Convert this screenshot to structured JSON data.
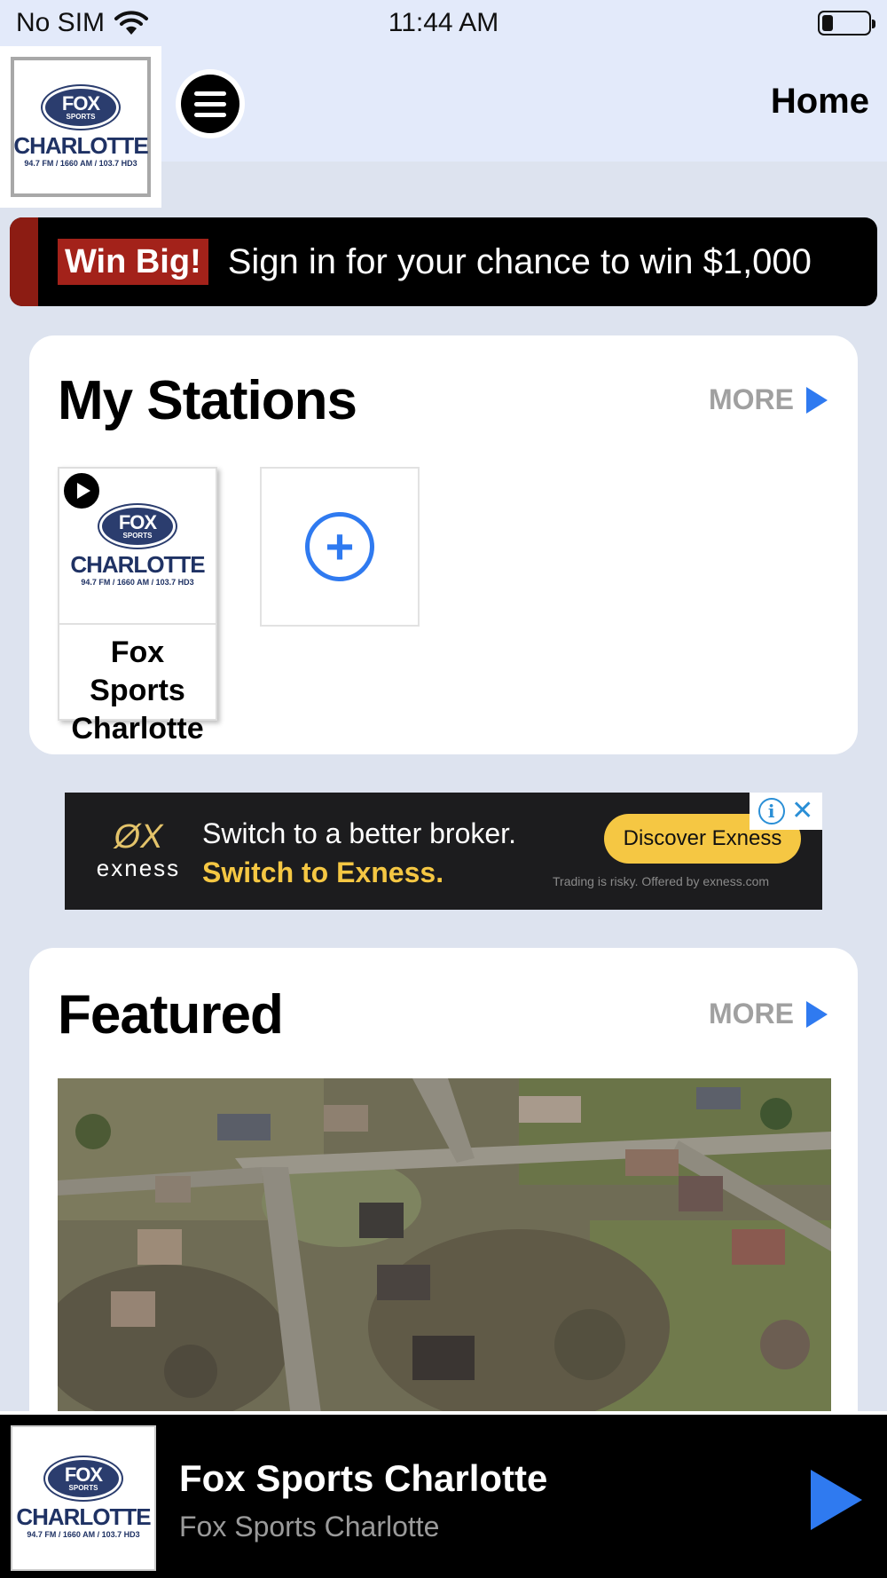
{
  "status_bar": {
    "carrier": "No SIM",
    "time": "11:44 AM"
  },
  "header": {
    "title": "Home",
    "logo": {
      "brand": "FOX",
      "sub": "SPORTS",
      "city": "CHARLOTTE",
      "frequencies": "94.7 FM / 1660 AM / 103.7 HD3"
    }
  },
  "promo": {
    "badge": "Win Big!",
    "text": "Sign in for your chance to win $1,000"
  },
  "my_stations": {
    "title": "My Stations",
    "more_label": "MORE",
    "stations": [
      {
        "name": "Fox Sports Charlotte"
      }
    ],
    "add_glyph": "+"
  },
  "ad": {
    "brand_mark": "ØX",
    "brand_name": "exness",
    "line1": "Switch to a better broker.",
    "line2": "Switch to Exness.",
    "cta": "Discover Exness",
    "disclaimer": "Trading is risky. Offered by exness.com",
    "info_glyph": "i",
    "close_glyph": "✕"
  },
  "featured": {
    "title": "Featured",
    "more_label": "MORE",
    "image_alt": "Aerial view of tornado-damaged neighborhood"
  },
  "player": {
    "title": "Fox Sports Charlotte",
    "subtitle": "Fox Sports Charlotte"
  },
  "colors": {
    "accent_blue": "#2f7af0",
    "promo_red": "#a3221a",
    "header_bg": "#e3eafa",
    "page_bg": "#dde3ef",
    "ad_yellow": "#f5c743"
  }
}
